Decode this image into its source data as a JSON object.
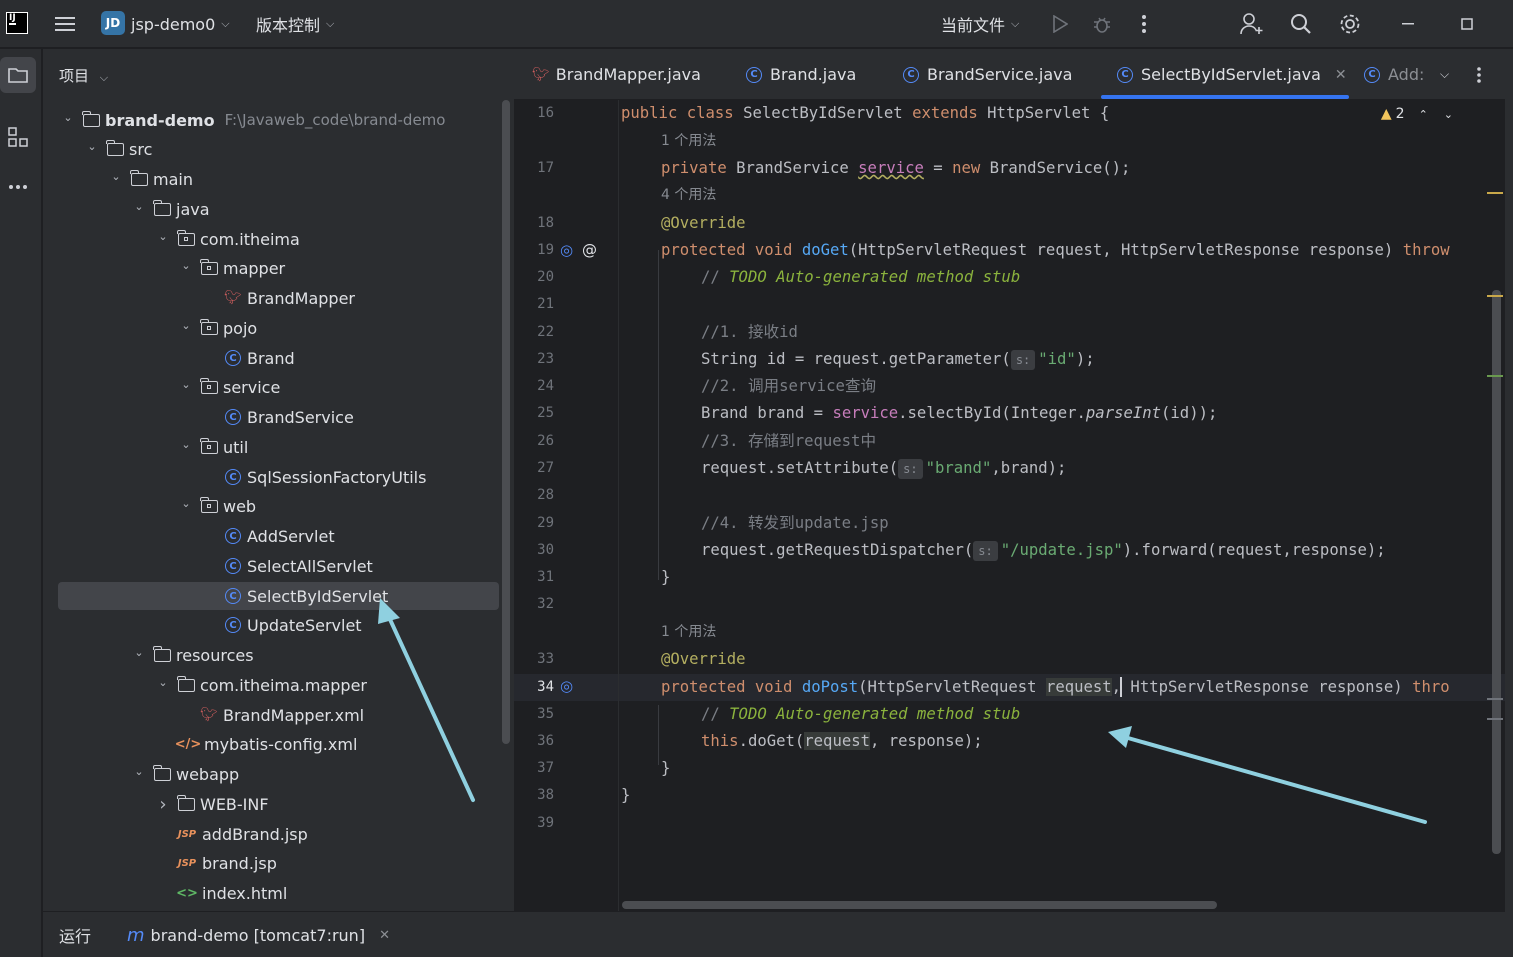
{
  "titlebar": {
    "logo": "IJ",
    "project_badge": "JD",
    "project_name": "jsp-demo0",
    "vcs_menu": "版本控制",
    "run_config": "当前文件"
  },
  "project_panel": {
    "header": "项目",
    "root_path": "F:\\Javaweb_code\\brand-demo",
    "tree": [
      {
        "label": "brand-demo",
        "kind": "module"
      },
      {
        "label": "src",
        "kind": "folder"
      },
      {
        "label": "main",
        "kind": "folder"
      },
      {
        "label": "java",
        "kind": "folder"
      },
      {
        "label": "com.itheima",
        "kind": "package"
      },
      {
        "label": "mapper",
        "kind": "package"
      },
      {
        "label": "BrandMapper",
        "kind": "mapper"
      },
      {
        "label": "pojo",
        "kind": "package"
      },
      {
        "label": "Brand",
        "kind": "class"
      },
      {
        "label": "service",
        "kind": "package"
      },
      {
        "label": "BrandService",
        "kind": "class"
      },
      {
        "label": "util",
        "kind": "package"
      },
      {
        "label": "SqlSessionFactoryUtils",
        "kind": "class"
      },
      {
        "label": "web",
        "kind": "package"
      },
      {
        "label": "AddServlet",
        "kind": "class"
      },
      {
        "label": "SelectAllServlet",
        "kind": "class"
      },
      {
        "label": "SelectByIdServlet",
        "kind": "class",
        "selected": true
      },
      {
        "label": "UpdateServlet",
        "kind": "class"
      },
      {
        "label": "resources",
        "kind": "folder"
      },
      {
        "label": "com.itheima.mapper",
        "kind": "folder"
      },
      {
        "label": "BrandMapper.xml",
        "kind": "mapper"
      },
      {
        "label": "mybatis-config.xml",
        "kind": "xml"
      },
      {
        "label": "webapp",
        "kind": "folder"
      },
      {
        "label": "WEB-INF",
        "kind": "folder"
      },
      {
        "label": "addBrand.jsp",
        "kind": "jsp"
      },
      {
        "label": "brand.jsp",
        "kind": "jsp"
      },
      {
        "label": "index.html",
        "kind": "html"
      }
    ]
  },
  "tabs": [
    {
      "label": "BrandMapper.java"
    },
    {
      "label": "Brand.java"
    },
    {
      "label": "BrandService.java"
    },
    {
      "label": "SelectByIdServlet.java",
      "active": true
    },
    {
      "label": "Add:"
    }
  ],
  "editor": {
    "warning_count": "2",
    "line_numbers": [
      "16",
      "17",
      "18",
      "19",
      "20",
      "21",
      "22",
      "23",
      "24",
      "25",
      "26",
      "27",
      "28",
      "29",
      "30",
      "31",
      "32",
      "33",
      "34",
      "35",
      "36",
      "37",
      "38",
      "39"
    ],
    "usage_hints": [
      "1 个用法",
      "4 个用法",
      "1 个用法"
    ],
    "param_hint": "s:",
    "code": {
      "l16_a": "public class ",
      "l16_b": "SelectByIdServlet ",
      "l16_c": "extends ",
      "l16_d": "HttpServlet {",
      "l17_a": "private ",
      "l17_b": "BrandService ",
      "l17_c": "service",
      "l17_d": " = ",
      "l17_e": "new ",
      "l17_f": "BrandService();",
      "l18": "@Override",
      "l19_a": "protected void ",
      "l19_b": "doGet",
      "l19_c": "(HttpServletRequest request, HttpServletResponse response) ",
      "l19_d": "throw",
      "l20_a": "// ",
      "l20_b": "TODO Auto-generated method stub",
      "l22": "//1. 接收id",
      "l23_a": "String id = request.getParameter(",
      "l23_b": "\"id\"",
      "l23_c": ");",
      "l24": "//2. 调用service查询",
      "l25_a": "Brand brand = ",
      "l25_b": "service",
      "l25_c": ".selectById(Integer.",
      "l25_d": "parseInt",
      "l25_e": "(id));",
      "l26": "//3. 存储到request中",
      "l27_a": "request.setAttribute(",
      "l27_b": "\"brand\"",
      "l27_c": ",brand);",
      "l29": "//4. 转发到update.jsp",
      "l30_a": "request.getRequestDispatcher(",
      "l30_b": "\"/update.jsp\"",
      "l30_c": ").forward(request,response);",
      "l31": "}",
      "l33": "@Override",
      "l34_a": "protected void ",
      "l34_b": "doPost",
      "l34_c": "(HttpServletRequest ",
      "l34_d": "request",
      "l34_e": ", HttpServletResponse response) ",
      "l34_f": "thro",
      "l35_a": "// ",
      "l35_b": "TODO Auto-generated method stub",
      "l36_a": "this",
      "l36_b": ".doGet(",
      "l36_c": "request",
      "l36_d": ", response);",
      "l37": "}",
      "l38": "}"
    }
  },
  "runbar": {
    "label": "运行",
    "config": "brand-demo [tomcat7:run]"
  },
  "colors": {
    "accent": "#3574f0",
    "arrow": "#8fd0e0"
  }
}
